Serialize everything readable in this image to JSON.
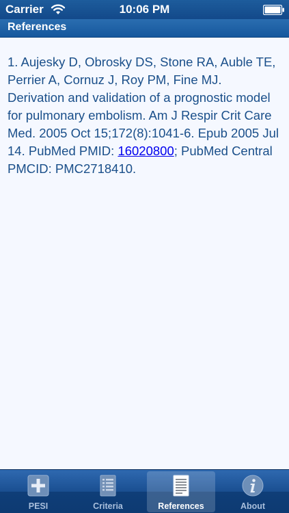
{
  "status_bar": {
    "carrier": "Carrier",
    "time": "10:06 PM"
  },
  "header": {
    "title": "References"
  },
  "reference": {
    "text_before_link": "1. Aujesky D, Obrosky DS, Stone RA, Auble TE, Perrier A, Cornuz J, Roy PM, Fine MJ. Derivation and validation of a prognostic model for pulmonary embolism. Am J Respir Crit Care Med. 2005 Oct 15;172(8):1041-6. Epub 2005 Jul 14. PubMed PMID: ",
    "pmid_link": "16020800",
    "text_after_link": "; PubMed Central PMCID: PMC2718410."
  },
  "tabs": [
    {
      "label": "PESI",
      "icon": "plus-icon",
      "active": false
    },
    {
      "label": "Criteria",
      "icon": "list-icon",
      "active": false
    },
    {
      "label": "References",
      "icon": "document-icon",
      "active": true
    },
    {
      "label": "About",
      "icon": "info-icon",
      "active": false
    }
  ],
  "colors": {
    "bar_blue": "#16589d",
    "text_blue": "#1a4f8a",
    "link_blue": "#0000ee",
    "background": "#f5f8ff"
  }
}
